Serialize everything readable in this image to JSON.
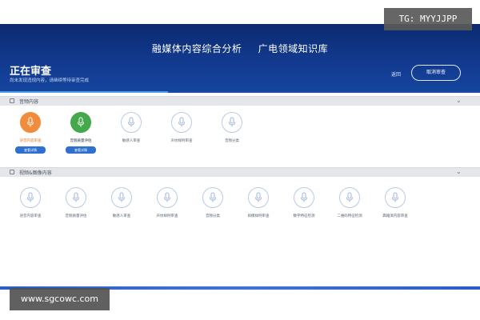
{
  "watermark_top": "TG: MYYJJPP",
  "watermark_bottom": "www.sgcowc.com",
  "header": {
    "title_left": "融媒体内容综合分析",
    "title_right": "广电领域知识库",
    "status_title": "正在审查",
    "status_sub": "尚未发现违规内容，请继续等待审查完成",
    "back_label": "返回",
    "cancel_label": "取消审查",
    "progress": 0.35
  },
  "section_audio": {
    "label": "音频内容",
    "items": [
      {
        "label": "语音内容审查",
        "state": "active-orange",
        "button": "查看详情"
      },
      {
        "label": "音频质量评估",
        "state": "active-green",
        "button": "查看详情"
      },
      {
        "label": "敏感人审查",
        "state": "idle"
      },
      {
        "label": "声纹样例审查",
        "state": "idle"
      },
      {
        "label": "音频分类",
        "state": "idle"
      }
    ]
  },
  "section_video": {
    "label": "视频&图像内容",
    "items": [
      {
        "label": "语音内容审查"
      },
      {
        "label": "音频质量评估"
      },
      {
        "label": "敏感人审查"
      },
      {
        "label": "声纹样例审查"
      },
      {
        "label": "音频分类"
      },
      {
        "label": "如模样例审查"
      },
      {
        "label": "数字特征检测"
      },
      {
        "label": "二维码特征检测"
      },
      {
        "label": "典籍演内容审查"
      }
    ]
  },
  "colors": {
    "header": "#123a8f",
    "accent_orange": "#f08c3c",
    "accent_green": "#45a84b",
    "button_blue": "#2f6fd0"
  }
}
